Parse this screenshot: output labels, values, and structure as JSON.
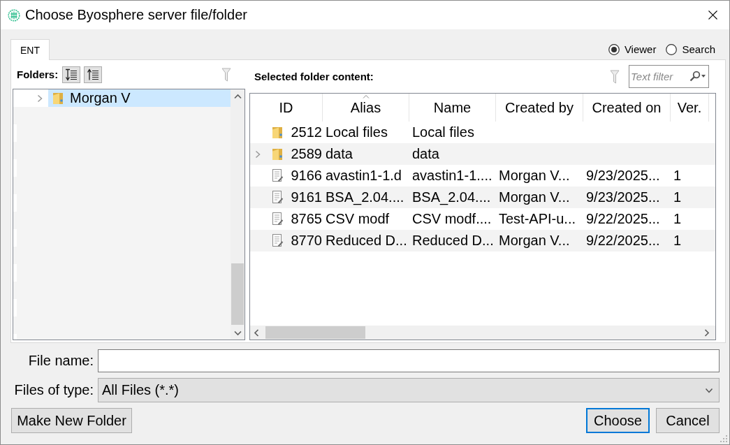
{
  "window": {
    "title": "Choose Byosphere server file/folder"
  },
  "tabs": [
    {
      "label": "ENT",
      "selected": true
    }
  ],
  "view_modes": [
    {
      "label": "Viewer",
      "selected": true
    },
    {
      "label": "Search",
      "selected": false
    }
  ],
  "folders": {
    "label": "Folders:",
    "tree": [
      {
        "label": "Morgan V",
        "expanded": false,
        "selected": true
      }
    ]
  },
  "content": {
    "label": "Selected folder content:",
    "filter": {
      "placeholder": "Text filter"
    },
    "table": {
      "columns": [
        {
          "label": "ID",
          "sorted": false
        },
        {
          "label": "Alias",
          "sorted": true
        },
        {
          "label": "Name",
          "sorted": false
        },
        {
          "label": "Created by",
          "sorted": false
        },
        {
          "label": "Created on",
          "sorted": false
        },
        {
          "label": "Ver.",
          "sorted": false
        }
      ],
      "rows": [
        {
          "kind": "folder",
          "expandable": false,
          "selected": false,
          "id": "2512",
          "alias": "Local files",
          "name": "Local files"
        },
        {
          "kind": "folder",
          "expandable": true,
          "selected": false,
          "id": "2589",
          "alias": "data",
          "name": "data"
        },
        {
          "kind": "file",
          "expandable": false,
          "selected": false,
          "id": "9166",
          "alias": "avastin1-1.d",
          "name": "avastin1-1....",
          "created_by": "Morgan V...",
          "created_on": "9/23/2025...",
          "version": "1"
        },
        {
          "kind": "file",
          "expandable": false,
          "selected": false,
          "id": "9161",
          "alias": "BSA_2.04....",
          "name": "BSA_2.04....",
          "created_by": "Morgan V...",
          "created_on": "9/23/2025...",
          "version": "1"
        },
        {
          "kind": "file",
          "expandable": false,
          "selected": false,
          "id": "8765",
          "alias": "CSV modf",
          "name": "CSV modf....",
          "created_by": "Test-API-u...",
          "created_on": "9/22/2025...",
          "version": "1"
        },
        {
          "kind": "file",
          "expandable": false,
          "selected": false,
          "id": "8770",
          "alias": "Reduced D...",
          "name": "Reduced D...",
          "created_by": "Morgan V...",
          "created_on": "9/22/2025...",
          "version": "1"
        }
      ]
    }
  },
  "file_name": {
    "label": "File name:"
  },
  "file_type": {
    "label": "Files of type:",
    "value": "All Files (*.*)"
  },
  "actions": [
    {
      "label": "Make New Folder",
      "default": false
    }
  ],
  "dialog_buttons": [
    {
      "label": "Choose",
      "default": true
    },
    {
      "label": "Cancel",
      "default": false
    }
  ]
}
